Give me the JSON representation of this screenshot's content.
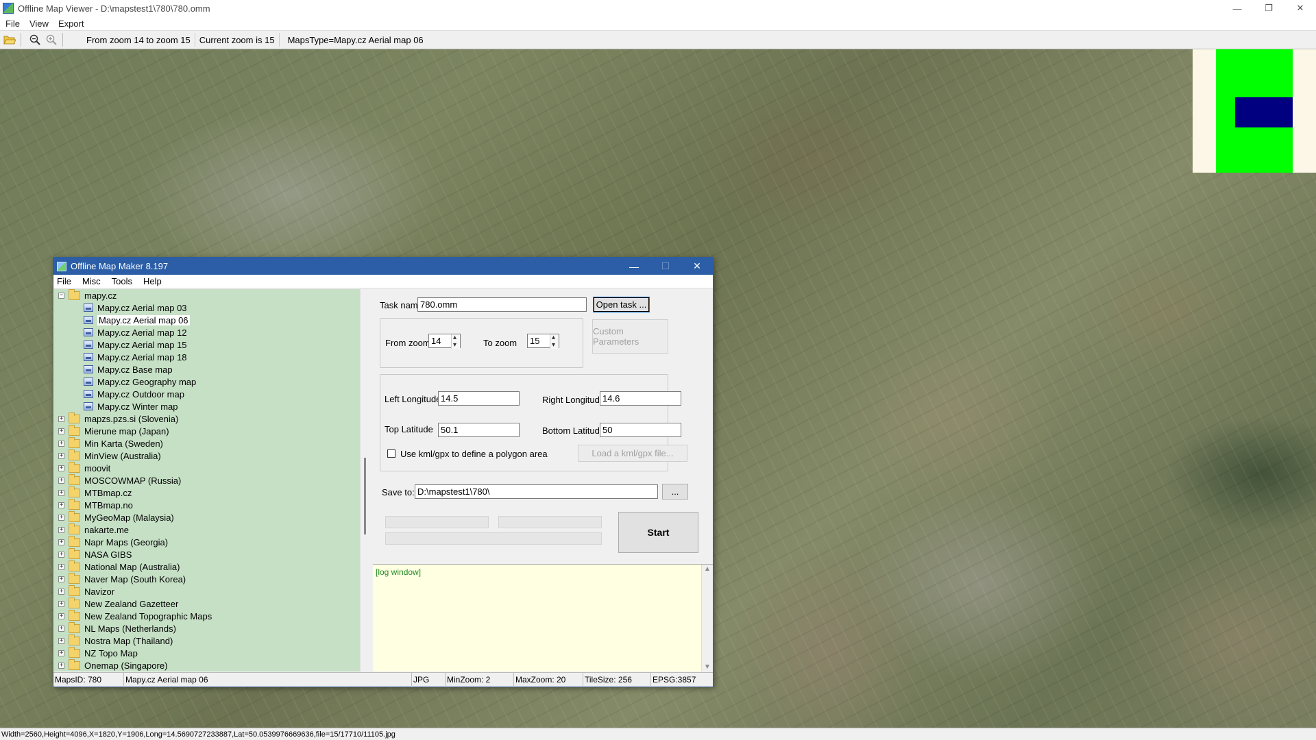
{
  "viewer": {
    "title": "Offline Map Viewer - D:\\mapstest1\\780\\780.omm",
    "menu": [
      "File",
      "View",
      "Export"
    ],
    "toolbar": {
      "zoom_range": "From zoom 14 to zoom 15",
      "current_zoom": "Current zoom is 15",
      "maps_type": "MapsType=Mapy.cz Aerial map 06"
    },
    "status": "Width=2560,Height=4096,X=1820,Y=1906,Long=14.5690727233887,Lat=50.0539976669636,file=15/17710/11105.jpg"
  },
  "dialog": {
    "title": "Offline Map Maker 8.197",
    "menu": [
      "File",
      "Misc",
      "Tools",
      "Help"
    ],
    "tree": {
      "expanded_root": "mapy.cz",
      "children": [
        "Mapy.cz Aerial map 03",
        "Mapy.cz Aerial map 06",
        "Mapy.cz Aerial map 12",
        "Mapy.cz Aerial map 15",
        "Mapy.cz Aerial map 18",
        "Mapy.cz Base map",
        "Mapy.cz Geography map",
        "Mapy.cz Outdoor map",
        "Mapy.cz Winter map"
      ],
      "selected_child_index": 1,
      "roots": [
        "mapzs.pzs.si (Slovenia)",
        "Mierune map (Japan)",
        "Min Karta (Sweden)",
        "MinView (Australia)",
        "moovit",
        "MOSCOWMAP (Russia)",
        "MTBmap.cz",
        "MTBmap.no",
        "MyGeoMap (Malaysia)",
        "nakarte.me",
        "Napr Maps (Georgia)",
        "NASA GIBS",
        "National Map (Australia)",
        "Naver Map (South Korea)",
        "Navizor",
        "New Zealand Gazetteer",
        "New Zealand Topographic Maps",
        "NL Maps (Netherlands)",
        "Nostra Map (Thailand)",
        "NZ Topo Map",
        "Onemap (Singapore)"
      ]
    },
    "form": {
      "task_name_label": "Task name",
      "task_name_value": "780.omm",
      "open_task_button": "Open task ...",
      "from_zoom_label": "From zoom",
      "from_zoom_value": "14",
      "to_zoom_label": "To zoom",
      "to_zoom_value": "15",
      "custom_params_button": "Custom Parameters",
      "left_lon_label": "Left Longitude",
      "left_lon_value": "14.5",
      "right_lon_label": "Right Longitude",
      "right_lon_value": "14.6",
      "top_lat_label": "Top Latitude",
      "top_lat_value": "50.1",
      "bottom_lat_label": "Bottom Latitude",
      "bottom_lat_value": "50",
      "kml_checkbox_label": "Use kml/gpx to define a polygon area",
      "kml_checked": false,
      "load_kml_button": "Load a kml/gpx file...",
      "save_to_label": "Save to:",
      "save_to_value": "D:\\mapstest1\\780\\",
      "browse_button": "...",
      "start_button": "Start"
    },
    "log": "[log window]",
    "status": {
      "maps_id": "MapsID: 780",
      "map_name": "Mapy.cz Aerial map 06",
      "format": "JPG",
      "min_zoom": "MinZoom: 2",
      "max_zoom": "MaxZoom: 20",
      "tile_size": "TileSize: 256",
      "epsg": "EPSG:3857"
    }
  },
  "colors": {
    "dialog_titlebar": "#2b5ea6",
    "tree_bg": "#c6e0c6",
    "log_bg": "#ffffe1",
    "overview_bg": "#fdf7e8",
    "overview_zoom": "#00ff00",
    "overview_view": "#000080"
  }
}
